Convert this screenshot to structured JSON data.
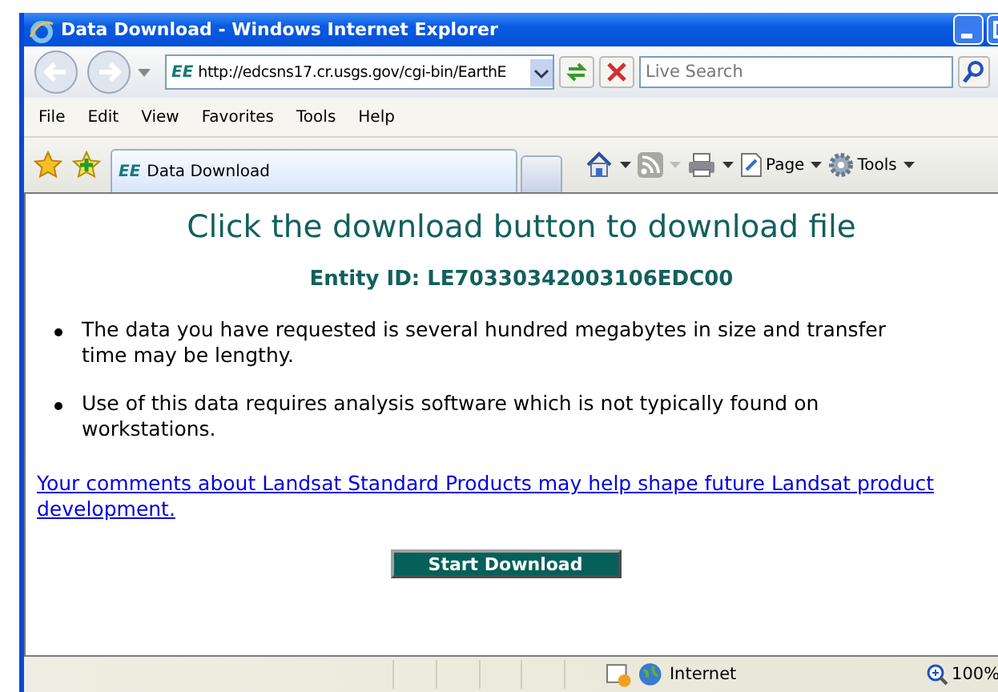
{
  "window": {
    "title": "Data Download - Windows Internet Explorer"
  },
  "address_bar": {
    "prefix": "EE",
    "value": "http://edcsns17.cr.usgs.gov/cgi-bin/EarthE"
  },
  "search": {
    "placeholder": "Live Search"
  },
  "menu": [
    {
      "label": "File"
    },
    {
      "label": "Edit"
    },
    {
      "label": "View"
    },
    {
      "label": "Favorites"
    },
    {
      "label": "Tools"
    },
    {
      "label": "Help"
    }
  ],
  "tab": {
    "prefix": "EE",
    "label": "Data Download",
    "selected": true
  },
  "command_bar": {
    "page": "Page",
    "tools": "Tools"
  },
  "page": {
    "heading": "Click the download button to download file",
    "entity": "Entity ID: LE70330342003106EDC00",
    "bullets": [
      "The data you have requested is several hundred megabytes in size and transfer time may be lengthy.",
      "Use of this data requires analysis software which is not typically found on workstations."
    ],
    "link": "Your comments about Landsat Standard Products may help shape future Landsat product development.",
    "button": "Start Download"
  },
  "status_bar": {
    "zone": "Internet",
    "zoom": "100%"
  }
}
